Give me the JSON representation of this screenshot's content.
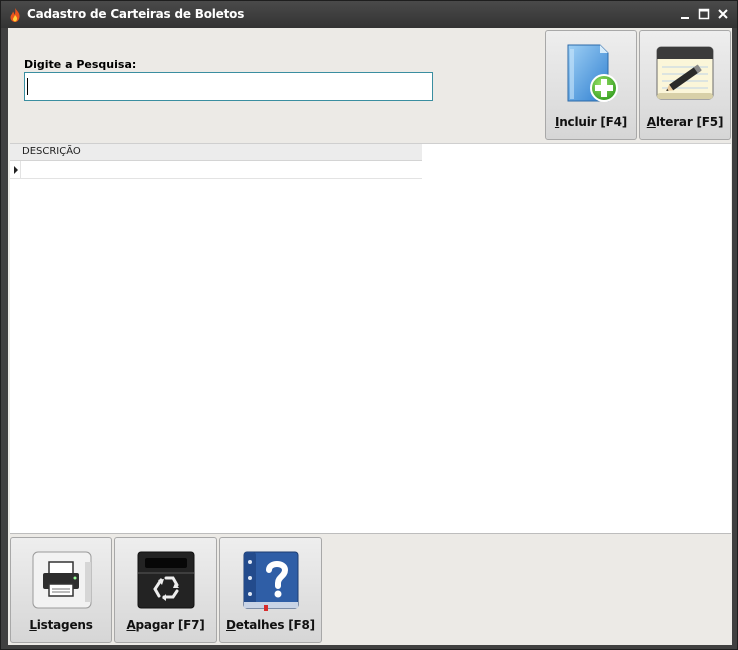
{
  "window": {
    "title": "Cadastro de Carteiras de Boletos",
    "app_icon": "flame-icon",
    "controls": [
      "minimize-icon",
      "maximize-icon",
      "close-icon"
    ]
  },
  "search": {
    "label": "Digite a Pesquisa:",
    "value": "",
    "placeholder": ""
  },
  "top_buttons": [
    {
      "mnemonic": "I",
      "rest": "ncluir [F4]",
      "icon": "folder-add-icon"
    },
    {
      "mnemonic": "A",
      "rest": "lterar [F5]",
      "icon": "notepad-pencil-icon"
    }
  ],
  "grid": {
    "columns": [
      "DESCRIÇÃO"
    ],
    "rows": [
      ""
    ]
  },
  "bottom_buttons": [
    {
      "mnemonic": "L",
      "rest": "istagens",
      "icon": "printer-icon"
    },
    {
      "mnemonic": "A",
      "rest": "pagar [F7]",
      "icon": "recycle-bin-icon"
    },
    {
      "mnemonic": "D",
      "rest": "etalhes [F8]",
      "icon": "help-book-icon"
    }
  ],
  "colors": {
    "titlebar": "#3a3a3a",
    "client_bg": "#eceae6",
    "input_border": "#3a8ea0"
  }
}
